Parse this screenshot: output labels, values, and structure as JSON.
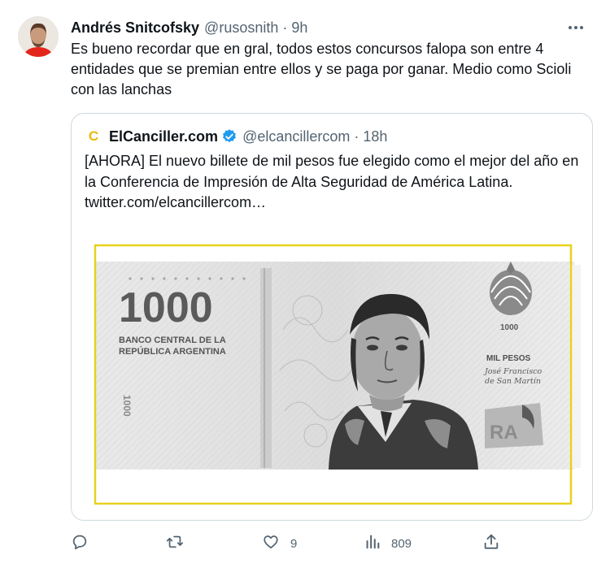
{
  "tweet": {
    "display_name": "Andrés Snitcofsky",
    "handle": "@rusosnith",
    "separator": "·",
    "time": "9h",
    "text": "Es bueno recordar que en gral, todos estos concursos falopa son entre 4 entidades que se premian entre ellos y se paga por ganar. Medio como Scioli con las lanchas"
  },
  "quote": {
    "logo_letter": "C",
    "display_name": "ElCanciller.com",
    "verified": true,
    "handle": "@elcancillercom",
    "separator": "·",
    "time": "18h",
    "text": "[AHORA] El nuevo billete de mil pesos fue elegido como el mejor del año en la Conferencia de Impresión de Alta Seguridad de América Latina.  twitter.com/elcancillercom…",
    "image": {
      "denomination": "1000",
      "bank_line1": "BANCO CENTRAL DE LA",
      "bank_line2": "REPÚBLICA ARGENTINA",
      "value_words": "MIL PESOS",
      "portrait_line1": "José Francisco",
      "portrait_line2": "de San Martín",
      "emblem_value": "1000",
      "vertical_digits": "1000",
      "watermark": "RA",
      "highlight_color": "#e8d11c"
    }
  },
  "actions": {
    "reply_count": "",
    "retweet_count": "",
    "like_count": "9",
    "views_count": "809"
  },
  "colors": {
    "text": "#0f1419",
    "secondary": "#536471",
    "border": "#cfd9de",
    "verified": "#1d9bf0"
  }
}
